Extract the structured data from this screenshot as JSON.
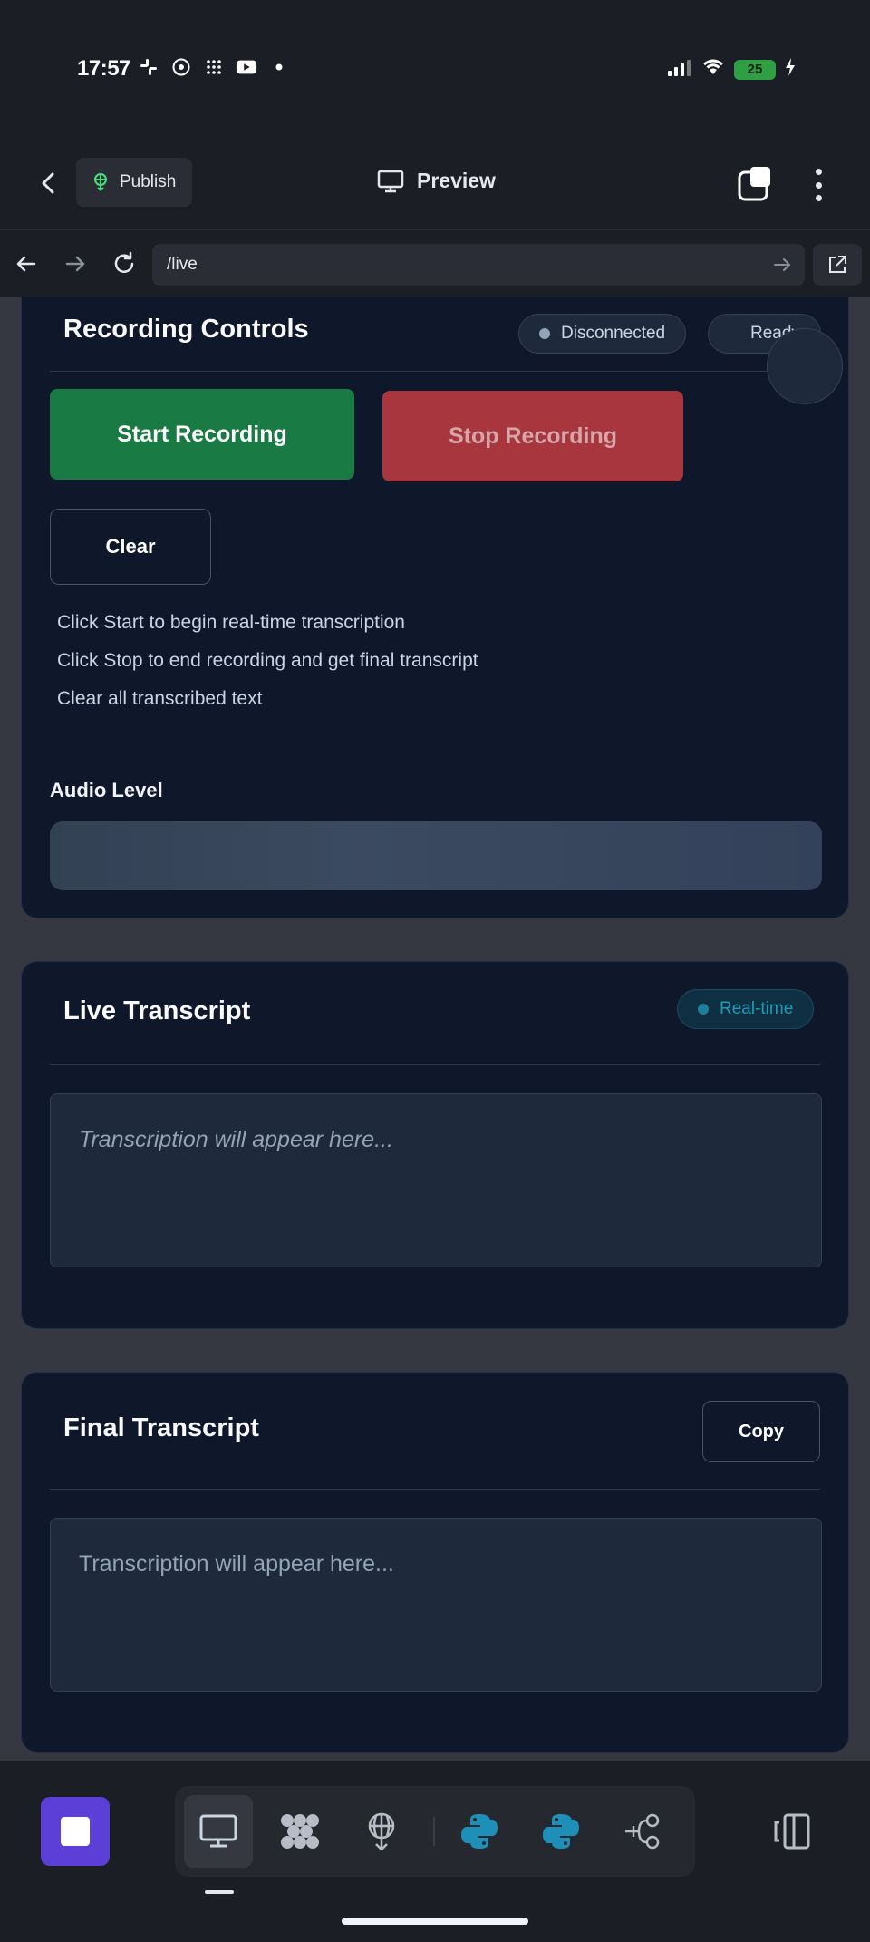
{
  "status_bar": {
    "time": "17:57",
    "app_icons": [
      "slack-icon",
      "whatsapp-icon",
      "grid-icon",
      "youtube-icon"
    ],
    "battery": "25"
  },
  "header": {
    "publish_label": "Publish",
    "preview_label": "Preview"
  },
  "browser": {
    "url": "/live"
  },
  "recording_card": {
    "title": "Recording Controls",
    "connection_status": "Disconnected",
    "state_badge": "Ready",
    "start_label": "Start Recording",
    "stop_label": "Stop Recording",
    "clear_label": "Clear",
    "help": [
      "Click Start to begin real-time transcription",
      "Click Stop to end recording and get final transcript",
      "Clear all transcribed text"
    ],
    "audio_level_label": "Audio Level",
    "audio_level": 0
  },
  "live_card": {
    "title": "Live Transcript",
    "badge": "Real-time",
    "placeholder": "Transcription will appear here..."
  },
  "final_card": {
    "title": "Final Transcript",
    "copy_label": "Copy",
    "placeholder": "Transcription will appear here..."
  },
  "colors": {
    "start_green": "#1a7a44",
    "stop_red": "#a8363e",
    "accent_purple": "#5b3fd6",
    "realtime_teal": "#1f7f99"
  }
}
